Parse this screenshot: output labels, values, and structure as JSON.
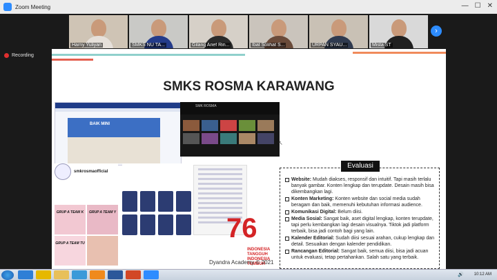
{
  "window": {
    "title": "Zoom Meeting",
    "minimize": "—",
    "maximize": "☐",
    "close": "✕"
  },
  "participants": [
    {
      "name": "Harny Yuliyan",
      "bg": "#cfc4b5",
      "shirt": "#e6e0da"
    },
    {
      "name": "SMKS NU TA...",
      "bg": "#c9c9c6",
      "shirt": "#243b8a"
    },
    {
      "name": "Gilang Arief Rin...",
      "bg": "#d6d0c8",
      "shirt": "#2a2a2a"
    },
    {
      "name": "Ibat Solihat S...",
      "bg": "#cac4bc",
      "shirt": "#6a4b3a"
    },
    {
      "name": "URPAN SYAU...",
      "bg": "#c9c1b5",
      "shirt": "#2f3a4f"
    },
    {
      "name": "Mista ST",
      "bg": "#d9d9d9",
      "shirt": "#202020"
    }
  ],
  "recording_label": "Recording",
  "slide": {
    "title": "SMKS ROSMA KARAWANG",
    "web_caption": "BAIK MINI",
    "yt_channel": "SMK ROSMA",
    "ig_handle": "smkrosmaofficial",
    "ig_tiles": [
      "GRUP A TEAM K",
      "GRUP A TEAM Y",
      "GRUP A TEAM TU",
      ""
    ],
    "logo_number": "76",
    "logo_text": [
      "INDONESIA",
      "TANGGUH",
      "INDONESIA",
      "TUMBUH"
    ],
    "eval_title": "Evaluasi",
    "eval_items": [
      {
        "head": "Website:",
        "text": " Mudah diakses, responsif dan intuitif. Tapi masih terlalu banyak gambar. Konten lengkap dan terupdate. Desain masih bisa dikembangkan lagi."
      },
      {
        "head": "Konten Marketing:",
        "text": " Konten website dan social media sudah beragam dan baik, memenuhi kebutuhan informasi audience."
      },
      {
        "head": "Komunikasi Digital:",
        "text": " Belum diisi."
      },
      {
        "head": "Media Sosial:",
        "text": " Sangat baik, aset digital lengkap, konten terupdate, tapi perlu kembangkan lagi desain visualnya. Tiktok jadi platform terbaik, bisa jadi contoh bagi yang lain."
      },
      {
        "head": "Kalender Editorial:",
        "text": " Sudah diisi sesuai arahan, cukup lengkap dan detail. Sesuaikan dengan kalender pendidikan."
      },
      {
        "head": "Rancangan Editorial:",
        "text": " Sangat baik, semua diisi, bisa jadi acuan untuk evaluasi, tetap pertahankan. Salah satu yang terbaik."
      }
    ],
    "footer": "Dyandra Academy © 2021"
  },
  "taskbar": {
    "time": "10:12 AM",
    "icons": [
      "ie",
      "chrome",
      "explorer",
      "media",
      "vlc",
      "word",
      "ppt",
      "zoom"
    ]
  }
}
